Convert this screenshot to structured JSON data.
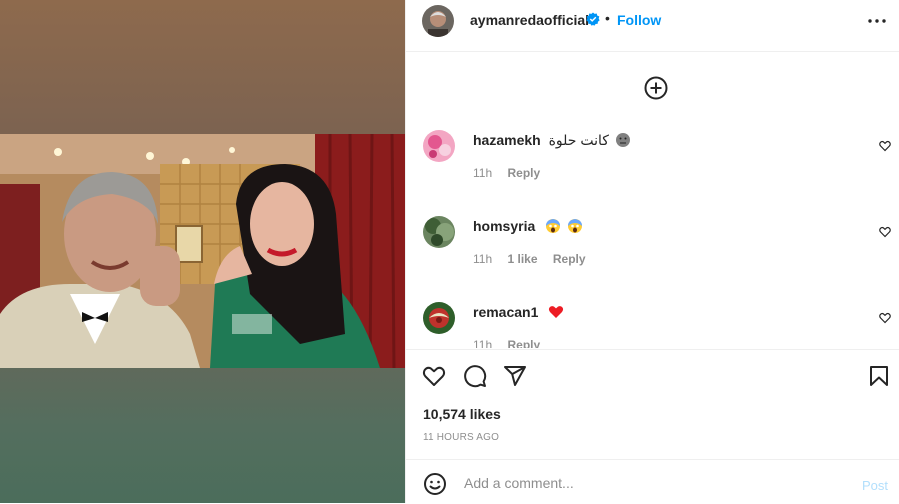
{
  "post": {
    "author": "aymanredaofficial",
    "separator": "•",
    "follow_label": "Follow"
  },
  "comments": [
    {
      "username": "hazamekh",
      "text": "كانت حلوة",
      "emoji": "neutral-face",
      "time": "11h",
      "likes": "",
      "reply": "Reply"
    },
    {
      "username": "homsyria",
      "text": "",
      "emoji": "screaming-face",
      "time": "11h",
      "likes": "1 like",
      "reply": "Reply"
    },
    {
      "username": "remacan1",
      "text": "",
      "emoji": "red-heart",
      "time": "11h",
      "likes": "",
      "reply": "Reply"
    }
  ],
  "stats": {
    "likes": "10,574 likes",
    "posted": "11 HOURS AGO"
  },
  "composer": {
    "placeholder": "Add a comment...",
    "post_label": "Post"
  },
  "colors": {
    "accent": "#0095f6",
    "post_disabled": "#b2dffc",
    "heart_red": "#ed1c24"
  },
  "icons": [
    "verified-badge-icon",
    "more-options-icon",
    "add-circle-icon",
    "heart-icon",
    "comment-icon",
    "share-icon",
    "bookmark-icon",
    "emoji-smiley-icon"
  ]
}
